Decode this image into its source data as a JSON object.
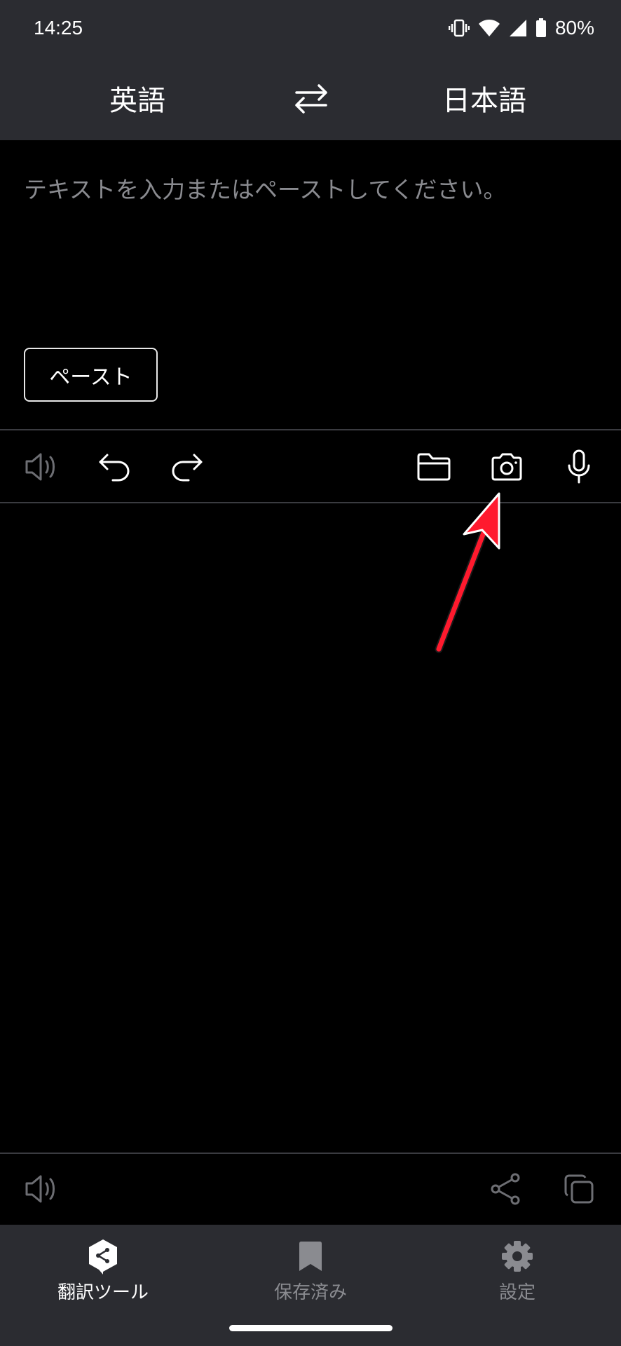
{
  "status_bar": {
    "time": "14:25",
    "battery_percent": "80%",
    "icons": [
      "vibrate-icon",
      "wifi-icon",
      "signal-icon",
      "battery-icon"
    ]
  },
  "language_bar": {
    "source_language": "英語",
    "target_language": "日本語",
    "swap_icon": "swap-arrows-icon"
  },
  "input": {
    "value": "",
    "placeholder": "テキストを入力またはペーストしてください。",
    "paste_label": "ペースト"
  },
  "input_toolbar": {
    "left_icons": [
      "speaker-icon",
      "undo-icon",
      "redo-icon"
    ],
    "right_icons": [
      "folder-icon",
      "camera-icon",
      "microphone-icon"
    ]
  },
  "annotation": {
    "arrow_color": "#ff1a2e",
    "points_to": "camera-icon"
  },
  "output_toolbar": {
    "left_icons": [
      "speaker-icon"
    ],
    "right_icons": [
      "share-icon",
      "copy-icon"
    ]
  },
  "bottom_nav": {
    "items": [
      {
        "label": "翻訳ツール",
        "icon": "deepl-logo-icon",
        "active": true
      },
      {
        "label": "保存済み",
        "icon": "bookmark-icon",
        "active": false
      },
      {
        "label": "設定",
        "icon": "gear-icon",
        "active": false
      }
    ]
  },
  "colors": {
    "bar_background": "#2b2c31",
    "content_background": "#000000",
    "divider": "#3a3b40",
    "muted_text": "#8a8b90"
  }
}
